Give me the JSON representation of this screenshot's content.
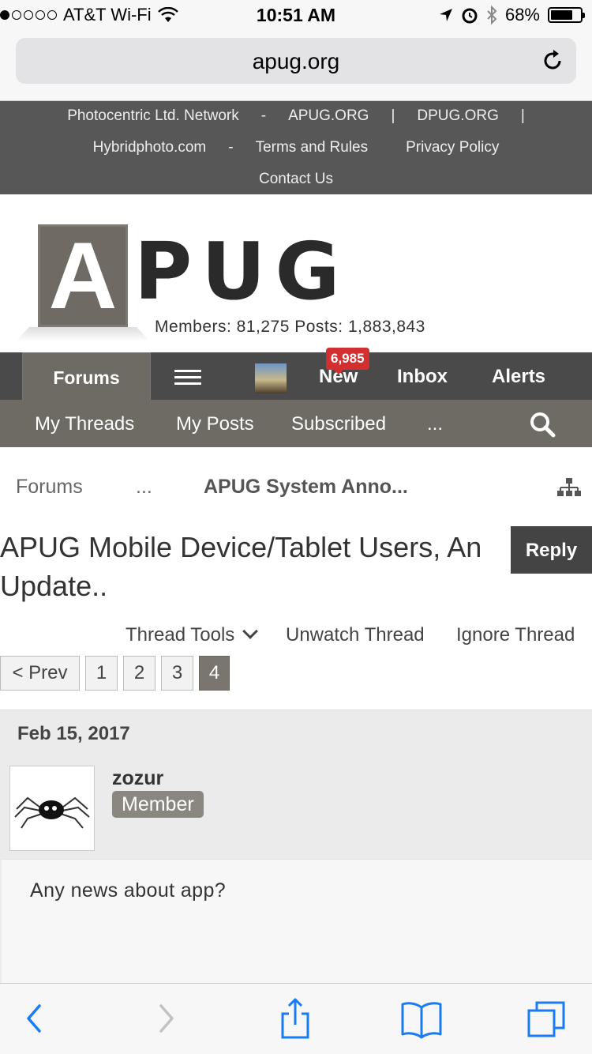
{
  "status_bar": {
    "carrier": "AT&T Wi-Fi",
    "time": "10:51 AM",
    "battery": "68%",
    "battery_level": 0.68
  },
  "browser": {
    "url": "apug.org"
  },
  "top_nav": {
    "links": [
      "Photocentric Ltd. Network",
      "-",
      "APUG.ORG",
      "|",
      "DPUG.ORG",
      "|",
      "Hybridphoto.com",
      "-",
      "Terms and Rules",
      "Privacy Policy",
      "Contact Us"
    ]
  },
  "header": {
    "logo_first_letter": "A",
    "logo_rest": "PUG",
    "stats": "Members: 81,275 Posts: 1,883,843"
  },
  "main_nav": {
    "forums": "Forums",
    "new": "New",
    "new_badge": "6,985",
    "inbox": "Inbox",
    "alerts": "Alerts"
  },
  "sub_nav": {
    "my_threads": "My Threads",
    "my_posts": "My Posts",
    "subscribed": "Subscribed",
    "more": "..."
  },
  "breadcrumb": {
    "forums": "Forums",
    "ellipsis": "...",
    "current": "APUG System Anno..."
  },
  "thread": {
    "title": "APUG Mobile Device/Tablet Users, An Update..",
    "reply": "Reply",
    "tools": "Thread Tools",
    "unwatch": "Unwatch Thread",
    "ignore": "Ignore Thread"
  },
  "pagination": {
    "prev": "< Prev",
    "pages": [
      "1",
      "2",
      "3",
      "4"
    ],
    "current": "4"
  },
  "post": {
    "date": "Feb 15, 2017",
    "username": "zozur",
    "role": "Member",
    "message": "Any news about app?"
  }
}
